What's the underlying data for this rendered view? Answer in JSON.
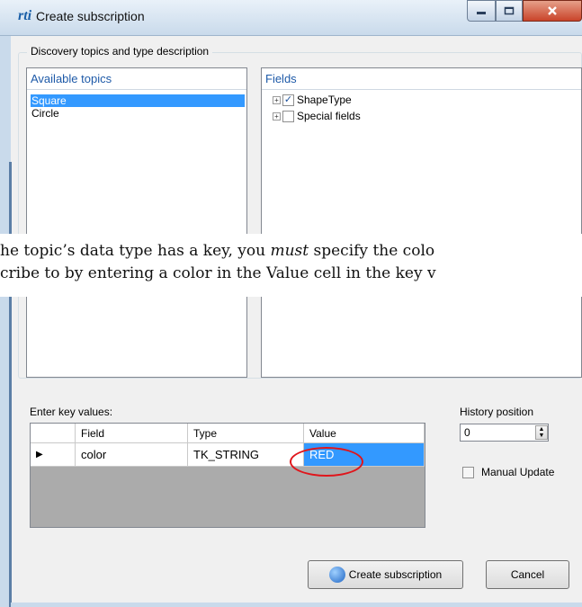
{
  "window": {
    "title": "Create subscription",
    "logo_text": "rti"
  },
  "group": {
    "legend": "Discovery topics and type description"
  },
  "topics": {
    "header": "Available topics",
    "items": [
      "Square",
      "Circle"
    ],
    "selected": "Square"
  },
  "fields": {
    "header": "Fields",
    "tree": [
      {
        "label": "ShapeType",
        "checked": true
      },
      {
        "label": "Special fields",
        "checked": false
      }
    ]
  },
  "doc_text": {
    "line1_a": "he topic’s data type has a key, you ",
    "line1_em": "must",
    "line1_b": " specify the colo",
    "line2": "cribe to by entering a color in the Value cell in the key v"
  },
  "key_values": {
    "label": "Enter key values:",
    "columns": [
      "Field",
      "Type",
      "Value"
    ],
    "rows": [
      {
        "marker": "▶",
        "field": "color",
        "type": "TK_STRING",
        "value": "RED"
      }
    ]
  },
  "history": {
    "label": "History position",
    "value": "0"
  },
  "manual_update": {
    "label": "Manual Update",
    "checked": false
  },
  "buttons": {
    "create": "Create subscription",
    "cancel": "Cancel"
  },
  "colors": {
    "selection": "#3399ff",
    "annotation_circle": "#e0151b",
    "header_text": "#1e5aa8"
  }
}
